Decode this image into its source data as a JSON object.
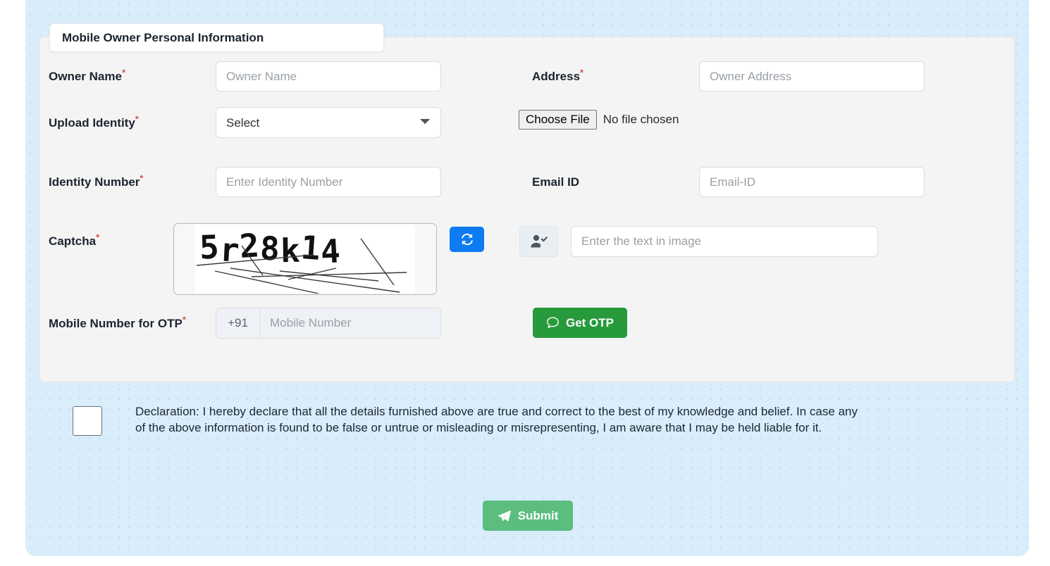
{
  "panel": {
    "background_color": "#d9edfb"
  },
  "form": {
    "legend": "Mobile Owner Personal Information",
    "fields": {
      "owner_name": {
        "label": "Owner Name",
        "required_mark": "*",
        "placeholder": "Owner Name",
        "value": ""
      },
      "address": {
        "label": "Address",
        "required_mark": "*",
        "placeholder": "Owner Address",
        "value": ""
      },
      "upload_identity": {
        "label": "Upload Identity",
        "required_mark": "*",
        "selected_option": "Select",
        "options": [
          "Select"
        ]
      },
      "file_upload": {
        "button_label": "Choose File",
        "status_text": "No file chosen"
      },
      "identity_number": {
        "label": "Identity Number",
        "required_mark": "*",
        "placeholder": "Enter Identity Number",
        "value": ""
      },
      "email_id": {
        "label": "Email ID",
        "required_mark": "",
        "placeholder": "Email-ID",
        "value": ""
      },
      "captcha": {
        "label": "Captcha",
        "required_mark": "*",
        "image_text": "5r28k14",
        "refresh_icon": "refresh-icon",
        "prefix_icon": "user-check-icon",
        "placeholder": "Enter the text in image",
        "value": ""
      },
      "mobile_otp": {
        "label": "Mobile Number for OTP",
        "required_mark": "*",
        "country_code": "+91",
        "placeholder": "Mobile Number",
        "value": "",
        "otp_button_label": "Get OTP",
        "otp_button_icon": "comment-icon",
        "otp_button_color": "#279a3c"
      }
    }
  },
  "declaration": {
    "checked": false,
    "text": "Declaration: I hereby declare that all the details furnished above are true and correct to the best of my knowledge and belief. In case any of the above information is found to be false or untrue or misleading or misrepresenting, I am aware that I may be held liable for it."
  },
  "submit": {
    "label": "Submit",
    "icon": "paper-plane-icon",
    "color": "#5bbd7e"
  }
}
